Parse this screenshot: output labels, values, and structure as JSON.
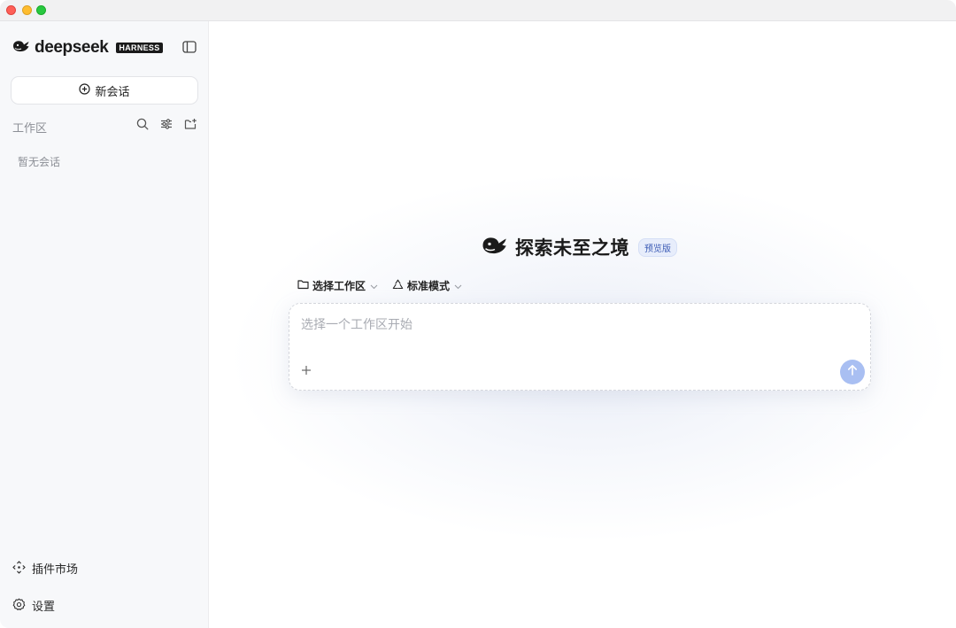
{
  "app": {
    "brand_text": "deepseek",
    "brand_badge": "HARNESS"
  },
  "sidebar": {
    "new_chat_label": "新会话",
    "workspace_label": "工作区",
    "empty_label": "暂无会话",
    "plugins_label": "插件市场",
    "settings_label": "设置"
  },
  "hero": {
    "title": "探索未至之境",
    "badge": "预览版"
  },
  "selectors": {
    "workspace": "选择工作区",
    "mode": "标准模式"
  },
  "composer": {
    "placeholder": "选择一个工作区开始"
  },
  "colors": {
    "accent": "#a9bff2",
    "badge_bg": "#e7edfb",
    "badge_text": "#3b5bb5"
  },
  "icons": {
    "brand": "whale-icon",
    "toggle": "sidebar-toggle-icon",
    "new_chat": "plus-circle-icon",
    "search": "search-icon",
    "filter": "sliders-icon",
    "new_folder": "folder-plus-icon",
    "plugins": "move-icon",
    "settings": "gear-icon",
    "folder": "folder-icon",
    "mode": "recycle-icon",
    "attach": "plus-icon",
    "send": "arrow-up-icon"
  }
}
